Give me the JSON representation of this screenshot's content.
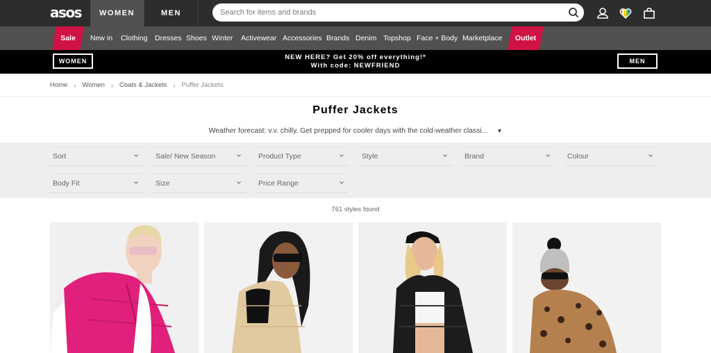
{
  "header": {
    "logo": "asos",
    "gender_tabs": [
      "WOMEN",
      "MEN"
    ],
    "active_gender": "WOMEN",
    "search_placeholder": "Search for items and brands",
    "icons": [
      "search-icon",
      "account-icon",
      "saved-items-heart-icon",
      "bag-icon"
    ]
  },
  "nav": {
    "items": [
      "Sale",
      "New in",
      "Clothing",
      "Dresses",
      "Shoes",
      "Winter",
      "Activewear",
      "Accessories",
      "Brands",
      "Denim",
      "Topshop",
      "Face + Body",
      "Marketplace",
      "Outlet"
    ],
    "highlighted": [
      "Sale",
      "Outlet"
    ],
    "accent_color": "#d01345"
  },
  "promo": {
    "left_button": "WOMEN",
    "right_button": "MEN",
    "line1": "NEW HERE? Get 20% off everything!*",
    "line2": "With code: NEWFRIEND"
  },
  "breadcrumb": [
    "Home",
    "Women",
    "Coats & Jackets",
    "Puffer Jackets"
  ],
  "page": {
    "title": "Puffer Jackets",
    "description": "Weather forecast: v.v. chilly. Get prepped for cooler days with the cold-weather classi..."
  },
  "filters": [
    "Sort",
    "Sale/ New Season",
    "Product Type",
    "Style",
    "Brand",
    "Colour",
    "Body Fit",
    "Size",
    "Price Range"
  ],
  "results": {
    "count_text": "761 styles found"
  },
  "products": [
    {
      "alt": "Model in pink puffer gilet with pink sunglasses"
    },
    {
      "alt": "Model in beige quilted gilet with black sunglasses"
    },
    {
      "alt": "Model in black The North Face puffer jacket with cap"
    },
    {
      "alt": "Model in leopard print puffer jacket with grey beanie"
    }
  ]
}
